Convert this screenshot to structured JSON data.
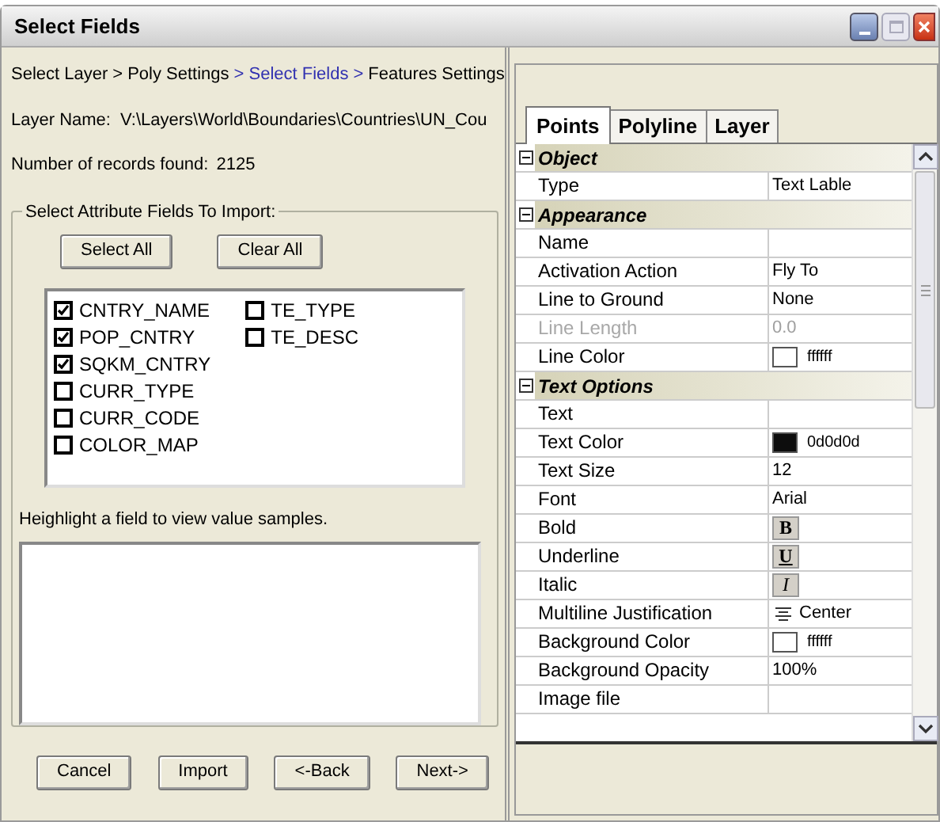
{
  "window": {
    "title": "Select Fields"
  },
  "breadcrumb": {
    "separator": ">",
    "steps": [
      {
        "label": "Select Layer",
        "selected": false
      },
      {
        "label": "Poly Settings",
        "selected": false
      },
      {
        "label": "Select Fields",
        "selected": true
      },
      {
        "label": "Features Settings",
        "selected": false
      }
    ]
  },
  "layer_name": {
    "label": "Layer Name:",
    "value": "V:\\Layers\\World\\Boundaries\\Countries\\UN_Cou"
  },
  "records": {
    "label": "Number of records found:",
    "value": "2125"
  },
  "attribute_group": {
    "title": "Select Attribute Fields To Import:",
    "buttons": [
      "Select All",
      "Clear All"
    ],
    "fields": [
      {
        "label": "CNTRY_NAME",
        "checked": true
      },
      {
        "label": "POP_CNTRY",
        "checked": true
      },
      {
        "label": "SQKM_CNTRY",
        "checked": true
      },
      {
        "label": "CURR_TYPE",
        "checked": false
      },
      {
        "label": "CURR_CODE",
        "checked": false
      },
      {
        "label": "COLOR_MAP",
        "checked": false
      },
      {
        "label": "TE_TYPE",
        "checked": false
      },
      {
        "label": "TE_DESC",
        "checked": false
      }
    ],
    "hint": "Heighlight a field to view value samples."
  },
  "buttons": [
    "Cancel",
    "Import",
    "<-Back",
    "Next->"
  ],
  "tabs": [
    {
      "label": "Points",
      "selected": true
    },
    {
      "label": "Polyline",
      "selected": false
    },
    {
      "label": "Layer",
      "selected": false
    }
  ],
  "properties": [
    {
      "kind": "category",
      "label": "Object",
      "expanded": true
    },
    {
      "kind": "text",
      "label": "Type",
      "value": "Text Lable",
      "disabled": false
    },
    {
      "kind": "category",
      "label": "Appearance",
      "expanded": true
    },
    {
      "kind": "text",
      "label": "Name",
      "disabled": false
    },
    {
      "kind": "text",
      "label": "Activation Action",
      "value": "Fly To",
      "disabled": false
    },
    {
      "kind": "text",
      "label": "Line to Ground",
      "value": "None",
      "disabled": false
    },
    {
      "kind": "text",
      "label": "Line Length",
      "value": "0.0",
      "disabled": true
    },
    {
      "kind": "color",
      "label": "Line Color",
      "value": "ffffff",
      "color": "#ffffff",
      "disabled": false
    },
    {
      "kind": "category",
      "label": "Text Options",
      "expanded": true
    },
    {
      "kind": "text",
      "label": "Text",
      "disabled": false
    },
    {
      "kind": "color",
      "label": "Text Color",
      "value": "0d0d0d",
      "color": "#0d0d0d",
      "disabled": false
    },
    {
      "kind": "text",
      "label": "Text Size",
      "value": "12",
      "disabled": false
    },
    {
      "kind": "text",
      "label": "Font",
      "value": "Arial",
      "disabled": false
    },
    {
      "kind": "bold",
      "label": "Bold",
      "value": "B",
      "disabled": false
    },
    {
      "kind": "underline",
      "label": "Underline",
      "value": "U",
      "disabled": false
    },
    {
      "kind": "italic",
      "label": "Italic",
      "value": "I",
      "disabled": false
    },
    {
      "kind": "justify",
      "label": "Multiline Justification",
      "value": "Center",
      "disabled": false
    },
    {
      "kind": "color",
      "label": "Background Color",
      "value": "ffffff",
      "color": "#ffffff",
      "disabled": false
    },
    {
      "kind": "text",
      "label": "Background Opacity",
      "value": "100%",
      "disabled": false
    },
    {
      "kind": "text",
      "label": "Image file",
      "disabled": false
    }
  ]
}
